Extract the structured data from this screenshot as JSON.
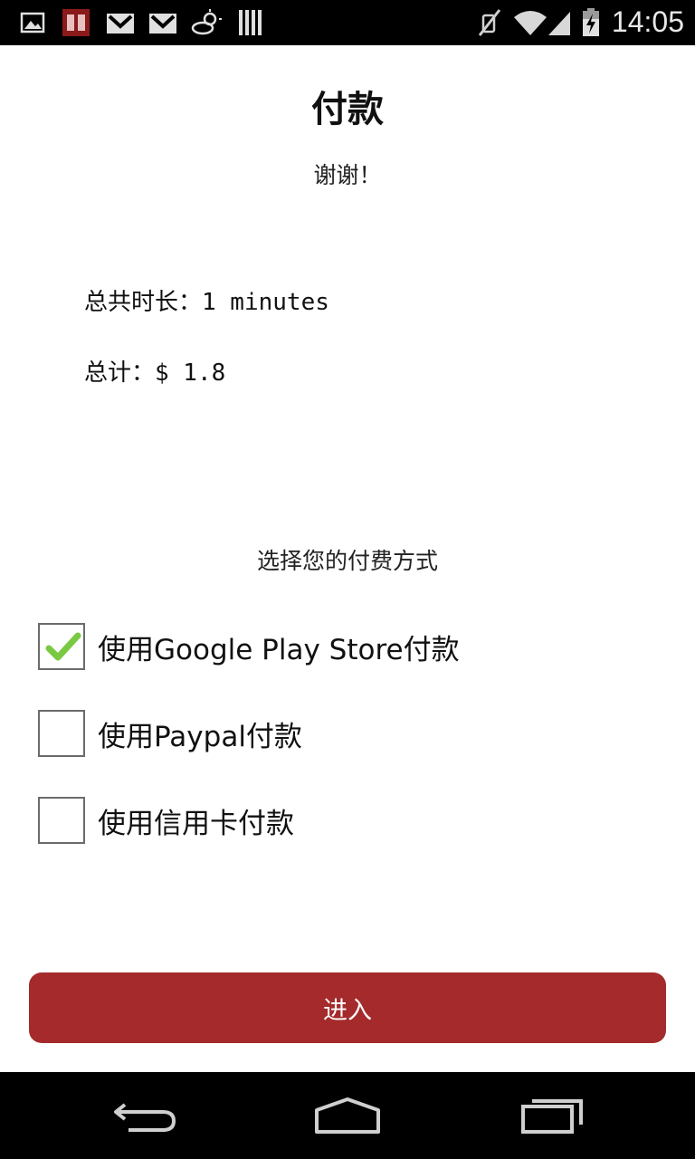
{
  "status_bar": {
    "time": "14:05",
    "left_icons": [
      "image-icon",
      "app-icon",
      "gmail-icon",
      "gmail-icon",
      "weather-icon",
      "barcode-icon"
    ],
    "right_icons": [
      "mute-icon",
      "wifi-icon",
      "signal-icon",
      "battery-charging-icon"
    ]
  },
  "page": {
    "title": "付款",
    "subtitle": "谢谢！",
    "duration_line": "总共时长：1 minutes",
    "total_line": "总计：$ 1.8",
    "choose_label": "选择您的付费方式"
  },
  "payment_options": [
    {
      "label": "使用Google Play Store付款",
      "checked": true
    },
    {
      "label": "使用Paypal付款",
      "checked": false
    },
    {
      "label": "使用信用卡付款",
      "checked": false
    }
  ],
  "enter_button": {
    "label": "进入"
  },
  "colors": {
    "accent": "#a42a2c",
    "checkmark": "#7ac943"
  },
  "nav_bar": {
    "buttons": [
      "back-icon",
      "home-icon",
      "recents-icon"
    ]
  }
}
